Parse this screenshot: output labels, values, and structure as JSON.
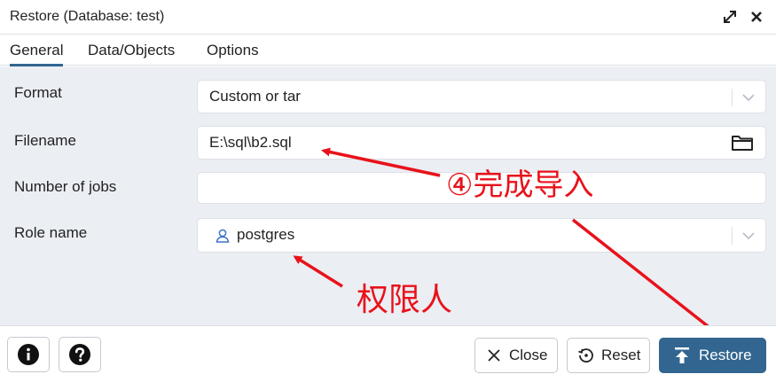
{
  "dialog": {
    "title": "Restore (Database: test)",
    "expand_icon": "expand-arrows-icon",
    "close_icon": "close-icon"
  },
  "tabs": [
    {
      "label": "General",
      "active": true
    },
    {
      "label": "Data/Objects",
      "active": false
    },
    {
      "label": "Options",
      "active": false
    }
  ],
  "form": {
    "format": {
      "label": "Format",
      "value": "Custom or tar"
    },
    "filename": {
      "label": "Filename",
      "value": "E:\\sql\\b2.sql",
      "icon": "folder-icon"
    },
    "jobs": {
      "label": "Number of jobs",
      "value": ""
    },
    "role": {
      "label": "Role name",
      "value": "postgres",
      "icon": "user-icon"
    }
  },
  "annotations": {
    "done": "④完成导入",
    "permission": "权限人",
    "color": "#e8121b"
  },
  "footer": {
    "info_icon": "info-icon",
    "help_icon": "help-icon",
    "close_label": "Close",
    "reset_label": "Reset",
    "restore_label": "Restore"
  },
  "colors": {
    "primary": "#326690",
    "panel_bg": "#ebeef3",
    "border": "#dde0e6"
  }
}
